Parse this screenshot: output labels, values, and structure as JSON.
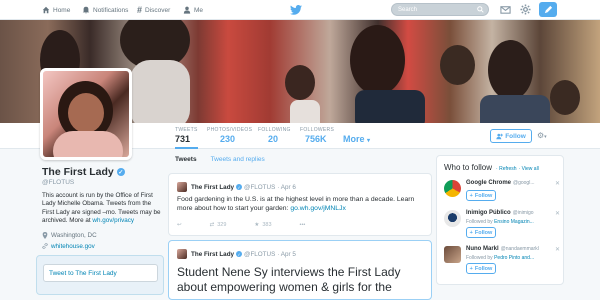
{
  "nav": {
    "home": "Home",
    "notifications": "Notifications",
    "discover": "Discover",
    "me": "Me",
    "search_placeholder": "Search"
  },
  "stats": [
    {
      "label": "TWEETS",
      "value": "731"
    },
    {
      "label": "PHOTOS/VIDEOS",
      "value": "230"
    },
    {
      "label": "FOLLOWING",
      "value": "20"
    },
    {
      "label": "FOLLOWERS",
      "value": "756K"
    }
  ],
  "more_label": "More",
  "follow_label": "Follow",
  "profile": {
    "name": "The First Lady",
    "handle": "@FLOTUS",
    "bio_text": "This account is run by the Office of First Lady Michelle Obama. Tweets from the First Lady are signed –mo. Tweets may be archived. More at",
    "bio_link": "wh.gov/privacy",
    "location": "Washington, DC",
    "website": "whitehouse.gov"
  },
  "tweet_to": "Tweet to The First Lady",
  "timeline": {
    "tab_tweets": "Tweets",
    "tab_replies": "Tweets and replies",
    "tweets": [
      {
        "name": "The First Lady",
        "handle": "@FLOTUS",
        "date": "· Apr 6",
        "text": "Food gardening in the U.S. is at the highest level in more than a decade. Learn more about how to start your garden:",
        "link": "go.wh.gov/jMNLJx",
        "retweets": "329",
        "favorites": "383"
      },
      {
        "name": "The First Lady",
        "handle": "@FLOTUS",
        "date": "· Apr 5",
        "text": "Student Nene Sy interviews the First Lady about empowering women & girls for the"
      }
    ]
  },
  "who_to_follow": {
    "title": "Who to follow",
    "refresh": "· Refresh",
    "view_all": "· View all",
    "suggestions": [
      {
        "name": "Google Chrome",
        "handle": "@googl...",
        "by_prefix": "",
        "by_link": "",
        "follow": "Follow"
      },
      {
        "name": "Inimigo Público",
        "handle": "@inimigo",
        "by_prefix": "Followed by",
        "by_link": "Ensino Magazin...",
        "follow": "Follow"
      },
      {
        "name": "Nuno Markl",
        "handle": "@nandaemmarkl",
        "by_prefix": "Followed by",
        "by_link": "Pedro Pinto and...",
        "follow": "Follow"
      }
    ]
  },
  "colors": {
    "accent": "#55acee",
    "link": "#0084b4"
  }
}
